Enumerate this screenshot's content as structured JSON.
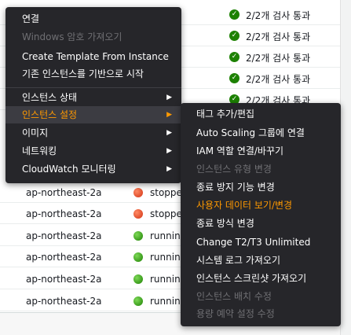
{
  "table": {
    "rows_top": [
      {
        "check": "2/2개 검사 통과"
      },
      {
        "check": "2/2개 검사 통과"
      },
      {
        "check": "2/2개 검사 통과"
      },
      {
        "check": "2/2개 검사 통과"
      },
      {
        "check": "2/2개 검사 통과"
      }
    ],
    "rows_bottom": [
      {
        "az": "ap-northeast-2a",
        "state": "stoppe",
        "status": "stopped"
      },
      {
        "az": "ap-northeast-2a",
        "state": "stoppe",
        "status": "stopped"
      },
      {
        "az": "ap-northeast-2a",
        "state": "running",
        "status": "running"
      },
      {
        "az": "ap-northeast-2a",
        "state": "running",
        "status": "running"
      },
      {
        "az": "ap-northeast-2a",
        "state": "running",
        "status": "running"
      },
      {
        "az": "ap-northeast-2a",
        "state": "running",
        "status": "running"
      }
    ]
  },
  "context_menu": {
    "items": [
      {
        "label": "연결",
        "disabled": false
      },
      {
        "label": "Windows 암호 가져오기",
        "disabled": true
      },
      {
        "label": "Create Template From Instance",
        "disabled": false
      },
      {
        "label": "기존 인스턴스를 기반으로 시작",
        "disabled": false
      }
    ],
    "submenus": [
      {
        "label": "인스턴스 상태",
        "active": false
      },
      {
        "label": "인스턴스 설정",
        "active": true
      },
      {
        "label": "이미지",
        "active": false
      },
      {
        "label": "네트워킹",
        "active": false
      },
      {
        "label": "CloudWatch 모니터링",
        "active": false
      }
    ]
  },
  "instance_settings_submenu": {
    "items": [
      {
        "label": "태그 추가/편집",
        "disabled": false
      },
      {
        "label": "Auto Scaling 그룹에 연결",
        "disabled": false
      },
      {
        "label": "IAM 역할 연결/바꾸기",
        "disabled": false
      },
      {
        "label": "인스턴스 유형 변경",
        "disabled": true
      },
      {
        "label": "종료 방지 기능 변경",
        "disabled": false
      },
      {
        "label": "사용자 데이터 보기/변경",
        "disabled": false,
        "highlight": true
      },
      {
        "label": "종료 방식 변경",
        "disabled": false
      },
      {
        "label": "Change T2/T3 Unlimited",
        "disabled": false
      },
      {
        "label": "시스템 로그 가져오기",
        "disabled": false
      },
      {
        "label": "인스턴스 스크린샷 가져오기",
        "disabled": false
      },
      {
        "label": "인스턴스 배치 수정",
        "disabled": true
      },
      {
        "label": "용량 예약 설정 수정",
        "disabled": true
      }
    ]
  },
  "colors": {
    "menu_bg": "#26262a",
    "highlight": "#ff9900",
    "running": "#1d8102",
    "stopped": "#d13212"
  }
}
